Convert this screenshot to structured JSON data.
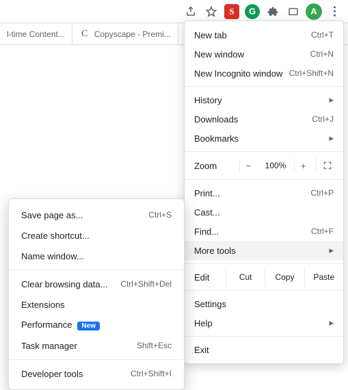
{
  "toolbar": {
    "avatar_letter": "A",
    "ext_s": "S",
    "ext_g": "G"
  },
  "tabs": [
    {
      "label": "l-time Content..."
    },
    {
      "label": "Copyscape - Premi..."
    },
    {
      "label": ""
    }
  ],
  "menu": {
    "new_tab": "New tab",
    "new_tab_accel": "Ctrl+T",
    "new_window": "New window",
    "new_window_accel": "Ctrl+N",
    "incognito": "New Incognito window",
    "incognito_accel": "Ctrl+Shift+N",
    "history": "History",
    "downloads": "Downloads",
    "downloads_accel": "Ctrl+J",
    "bookmarks": "Bookmarks",
    "zoom_label": "Zoom",
    "zoom_value": "100%",
    "print": "Print...",
    "print_accel": "Ctrl+P",
    "cast": "Cast...",
    "find": "Find...",
    "find_accel": "Ctrl+F",
    "more_tools": "More tools",
    "edit_label": "Edit",
    "cut": "Cut",
    "copy": "Copy",
    "paste": "Paste",
    "settings": "Settings",
    "help": "Help",
    "exit": "Exit"
  },
  "submenu": {
    "save_page": "Save page as...",
    "save_page_accel": "Ctrl+S",
    "create_shortcut": "Create shortcut...",
    "name_window": "Name window...",
    "clear_data": "Clear browsing data...",
    "clear_data_accel": "Ctrl+Shift+Del",
    "extensions": "Extensions",
    "performance": "Performance",
    "perf_badge": "New",
    "task_manager": "Task manager",
    "task_manager_accel": "Shift+Esc",
    "devtools": "Developer tools",
    "devtools_accel": "Ctrl+Shift+I"
  }
}
